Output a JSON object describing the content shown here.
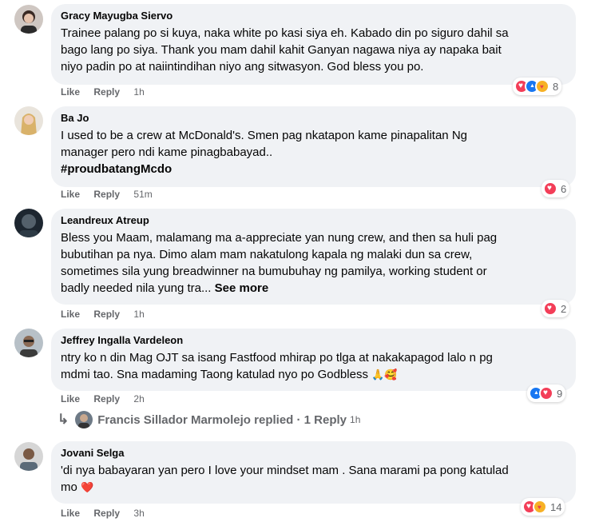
{
  "comments": [
    {
      "author": "Gracy Mayugba Siervo",
      "text": "Trainee palang po si kuya, naka white po kasi siya eh. Kabado din po siguro dahil sa\nbago lang po siya. Thank you mam dahil kahit Ganyan nagawa niya ay napaka bait\nniyo padin po at naiintindihan niyo ang sitwasyon. God bless you po.",
      "like": "Like",
      "reply": "Reply",
      "time": "1h",
      "reactions": [
        "love-icon",
        "like-icon",
        "care-icon"
      ],
      "reaction_count": "8"
    },
    {
      "author": "Ba Jo",
      "text": "I used to be a crew at McDonald's. Smen pag nkatapon kame pinapalitan Ng\nmanager pero ndi kame pinagbabayad..",
      "hashtag": "#proudbatangMcdo",
      "like": "Like",
      "reply": "Reply",
      "time": "51m",
      "reactions": [
        "love-icon"
      ],
      "reaction_count": "6"
    },
    {
      "author": "Leandreux Atreup",
      "text": "Bless you Maam, malamang ma a-appreciate yan nung crew, and then sa huli pag\nbubutihan pa nya. Dimo alam mam nakatulong kapala ng malaki dun sa crew,\nsometimes sila yung breadwinner na bumubuhay ng pamilya, working student or\nbadly needed nila yung tra... ",
      "see_more": "See more",
      "like": "Like",
      "reply": "Reply",
      "time": "1h",
      "reactions": [
        "love-icon"
      ],
      "reaction_count": "2"
    },
    {
      "author": "Jeffrey Ingalla Vardeleon",
      "text": "ntry ko n din Mag OJT sa isang Fastfood mhirap po tlga at nakakapagod lalo n pg\nmdmi tao. Sna madaming Taong katulad nyo po Godbless",
      "emojis": "🙏🥰",
      "like": "Like",
      "reply": "Reply",
      "time": "2h",
      "reactions": [
        "like-icon",
        "love-icon"
      ],
      "reaction_count": "9"
    },
    {
      "author": "Jovani Selga",
      "text": "'di nya babayaran yan pero I love your mindset mam . Sana marami pa pong katulad\nmo",
      "emojis": "❤️",
      "like": "Like",
      "reply": "Reply",
      "time": "3h",
      "reactions": [
        "love-icon",
        "care-icon"
      ],
      "reaction_count": "14"
    }
  ],
  "reply_summary": {
    "author": "Francis Sillador Marmolejo",
    "label": "replied · 1 Reply",
    "time": "1h"
  }
}
